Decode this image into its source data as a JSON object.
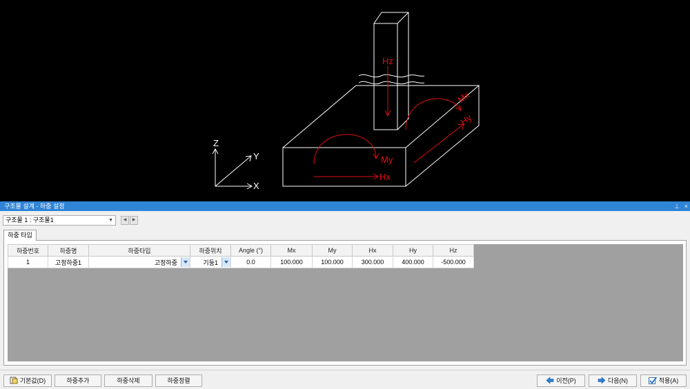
{
  "viewport": {
    "labels": {
      "hz": "Hz",
      "mx": "Mx",
      "hy": "Hy",
      "my": "My",
      "hx": "Hx",
      "axis_z": "Z",
      "axis_y": "Y",
      "axis_x": "X"
    },
    "colors": {
      "background": "#000000",
      "wire": "#ffffff",
      "load": "#e01010"
    }
  },
  "panel": {
    "title": "구조물 설계 - 하중 설정",
    "pin_icon": "pin-icon",
    "close_glyph": "×"
  },
  "structure_select": {
    "value": "구조물 1 : 구조물1"
  },
  "tab": {
    "label": "하중 타입"
  },
  "table": {
    "headers": [
      "하중번호",
      "하중명",
      "하중타입",
      "하중위치",
      "Angle (°)",
      "Mx",
      "My",
      "Hx",
      "Hy",
      "Hz"
    ],
    "rows": [
      {
        "no": "1",
        "name": "고정하중1",
        "type": "고정하중",
        "position": "기둥1",
        "angle": "0.0",
        "mx": "100.000",
        "my": "100.000",
        "hx": "300.000",
        "hy": "400.000",
        "hz": "-500.000"
      }
    ]
  },
  "buttons": {
    "default": "기본값(D)",
    "add": "하중추가",
    "delete": "하중삭제",
    "sort": "하중정렬",
    "prev": "이전(P)",
    "next": "다음(N)",
    "apply": "적용(A)"
  },
  "colors": {
    "title_bar": "#2f84d6",
    "grid_empty": "#a0a0a0"
  }
}
